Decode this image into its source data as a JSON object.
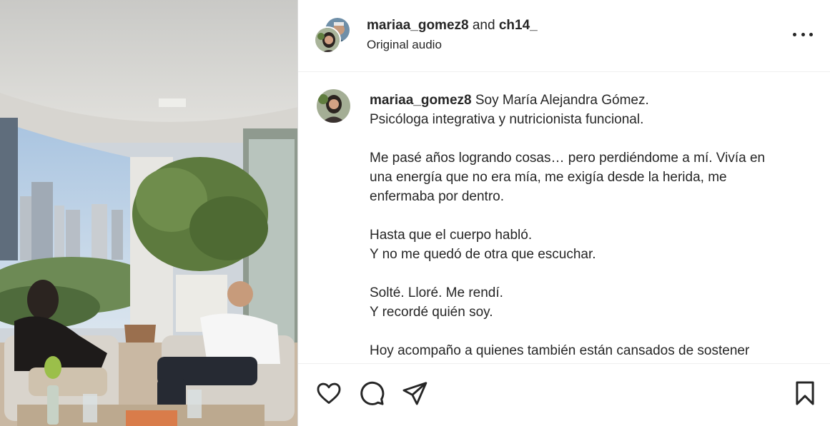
{
  "post": {
    "author1": "mariaa_gomez8",
    "conjunction": "and",
    "author2": "ch14_",
    "audio": "Original audio"
  },
  "caption": {
    "username": "mariaa_gomez8",
    "lines": [
      "Soy María Alejandra Gómez.",
      "Psicóloga integrativa y nutricionista funcional.",
      "",
      "Me pasé años logrando cosas… pero perdiéndome a mí. Vivía en",
      "una energía que no era mía, me exigía desde la herida, me",
      "enfermaba por dentro.",
      "",
      "Hasta que el cuerpo habló.",
      "Y no me quedó de otra que escuchar.",
      "",
      "Solté. Lloré. Me rendí.",
      "Y recordé quién soy.",
      "",
      "Hoy acompaño a quienes también están cansados de sostener"
    ]
  },
  "icons": {
    "more": "more-options-icon",
    "like": "heart-icon",
    "comment": "comment-icon",
    "share": "share-icon",
    "save": "bookmark-icon"
  },
  "colors": {
    "text": "#262626",
    "divider": "#dbdbdb"
  }
}
